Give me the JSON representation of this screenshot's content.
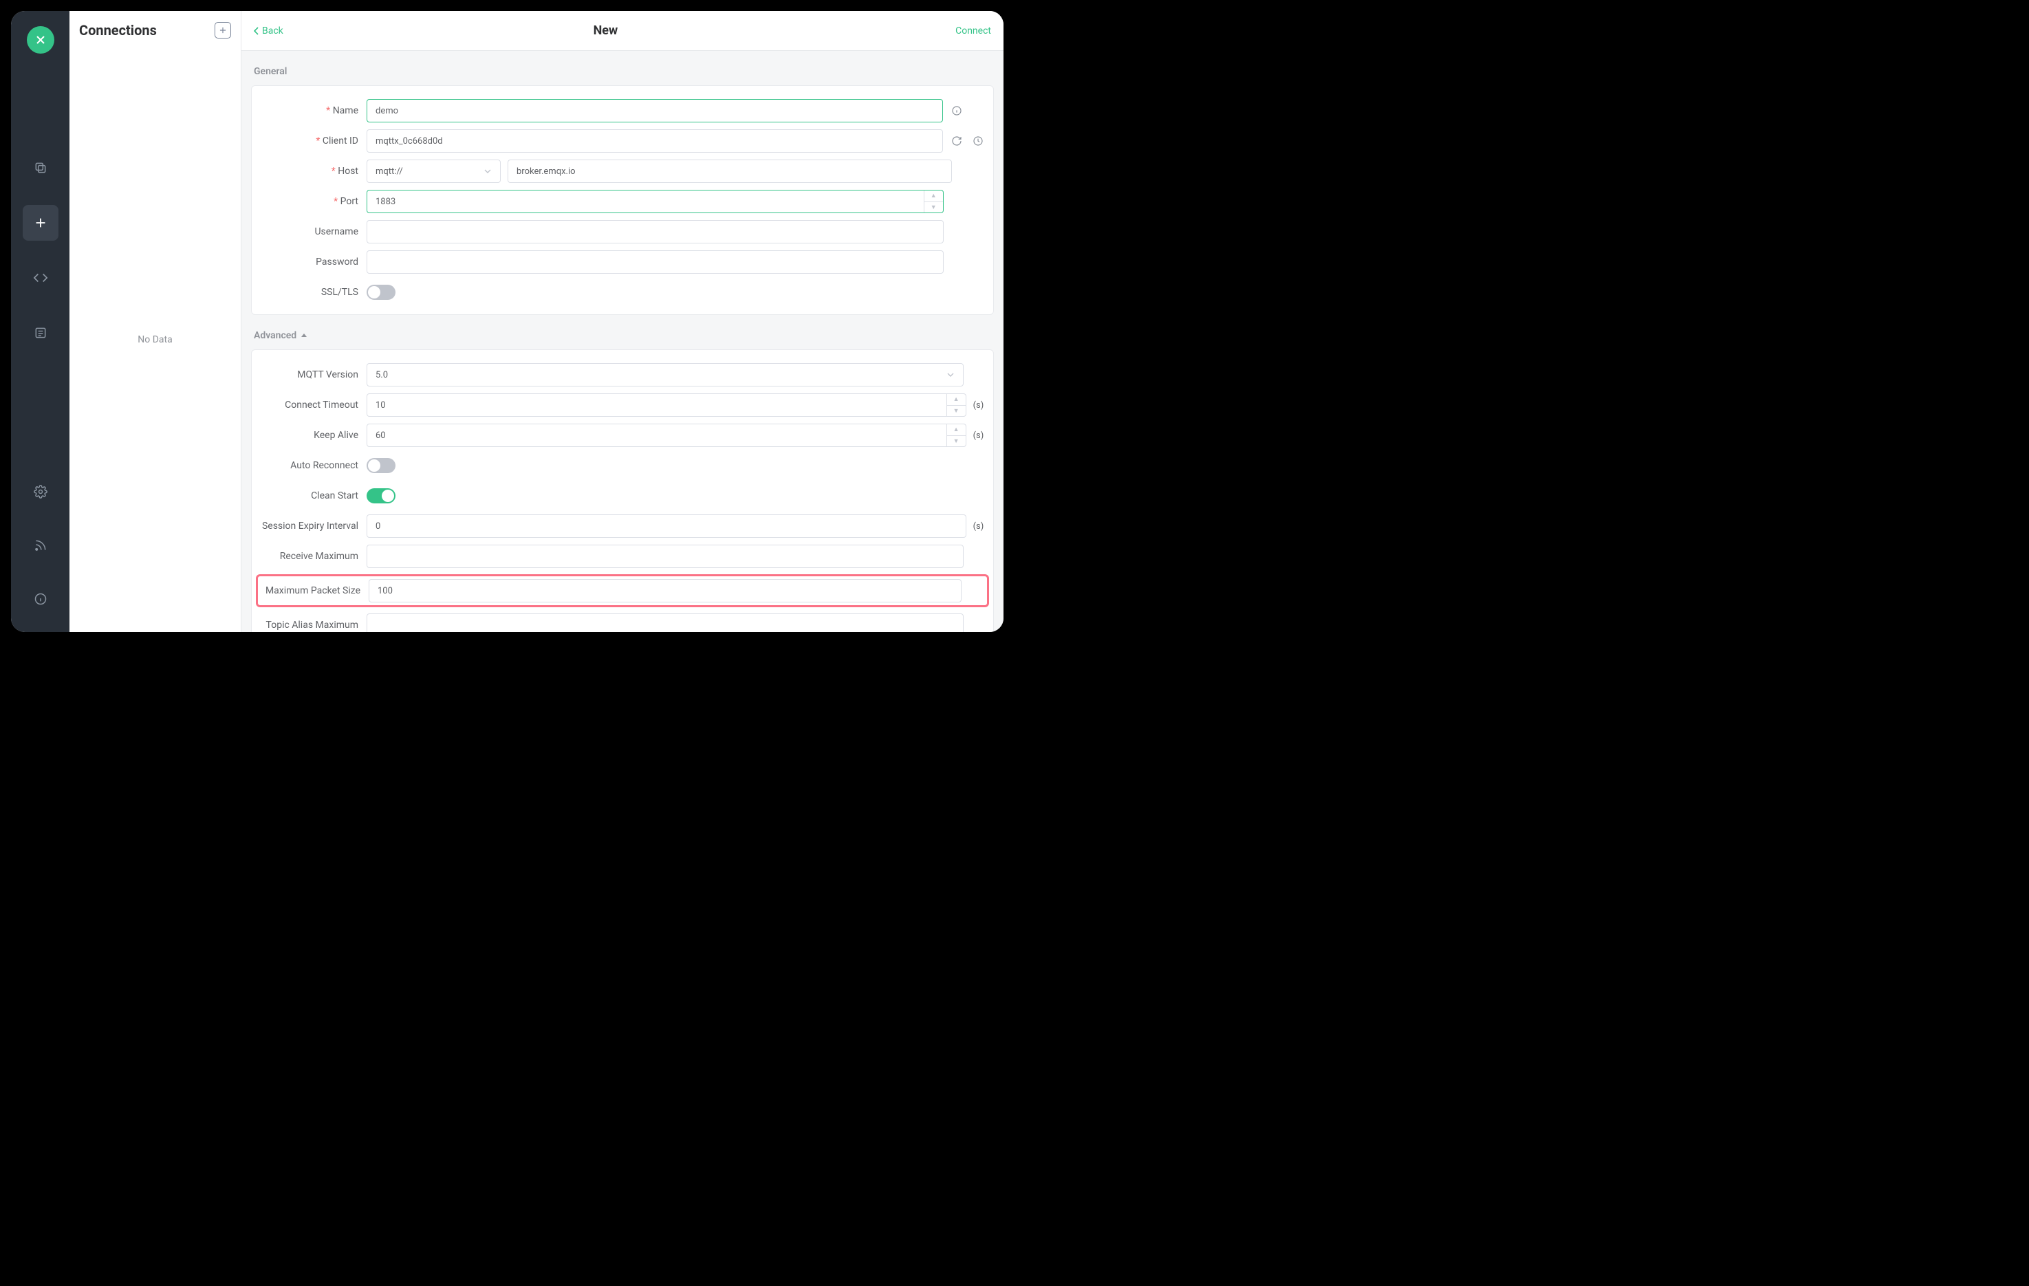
{
  "sidebar": {
    "items": [
      "copy-icon",
      "plus-icon",
      "code-icon",
      "list-icon"
    ],
    "bottom": [
      "gear-icon",
      "rss-icon",
      "info-icon"
    ]
  },
  "connections": {
    "title": "Connections",
    "empty": "No Data"
  },
  "topbar": {
    "back": "Back",
    "title": "New",
    "connect": "Connect"
  },
  "sections": {
    "general": "General",
    "advanced": "Advanced"
  },
  "general": {
    "labels": {
      "name": "Name",
      "client_id": "Client ID",
      "host": "Host",
      "port": "Port",
      "username": "Username",
      "password": "Password",
      "ssl": "SSL/TLS"
    },
    "name": "demo",
    "client_id": "mqttx_0c668d0d",
    "host_scheme": "mqtt://",
    "host_value": "broker.emqx.io",
    "port": "1883",
    "username": "",
    "password": "",
    "ssl": false
  },
  "advanced": {
    "labels": {
      "mqtt_version": "MQTT Version",
      "connect_timeout": "Connect Timeout",
      "keep_alive": "Keep Alive",
      "auto_reconnect": "Auto Reconnect",
      "clean_start": "Clean Start",
      "session_expiry": "Session Expiry Interval",
      "receive_max": "Receive Maximum",
      "max_packet": "Maximum Packet Size",
      "topic_alias_max": "Topic Alias Maximum"
    },
    "mqtt_version": "5.0",
    "connect_timeout": "10",
    "keep_alive": "60",
    "auto_reconnect": false,
    "clean_start": true,
    "session_expiry": "0",
    "receive_max": "",
    "max_packet": "100",
    "topic_alias_max": "",
    "unit_seconds": "(s)"
  }
}
